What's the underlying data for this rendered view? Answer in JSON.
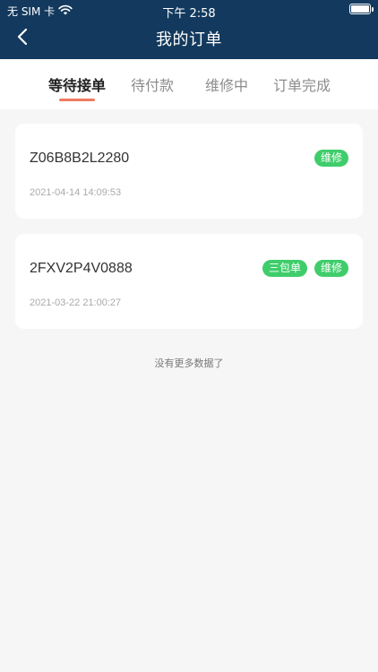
{
  "status_bar": {
    "carrier": "无 SIM 卡",
    "time": "下午 2:58"
  },
  "nav": {
    "title": "我的订单"
  },
  "tabs": [
    {
      "label": "等待接单",
      "active": true
    },
    {
      "label": "待付款",
      "active": false
    },
    {
      "label": "维修中",
      "active": false
    },
    {
      "label": "订单完成",
      "active": false
    }
  ],
  "orders": [
    {
      "order_no": "Z06B8B2L2280",
      "date": "2021-04-14 14:09:53",
      "badges": [
        "维修"
      ]
    },
    {
      "order_no": "2FXV2P4V0888",
      "date": "2021-03-22 21:00:27",
      "badges": [
        "三包单",
        "维修"
      ]
    }
  ],
  "footer": {
    "no_more": "没有更多数据了"
  },
  "colors": {
    "header_bg": "#133a5e",
    "tab_accent": "#f07a60",
    "badge_bg": "#3fcd6b",
    "page_bg": "#f6f6f6"
  },
  "icons": [
    "wifi-icon",
    "battery-icon",
    "back-arrow-icon"
  ]
}
